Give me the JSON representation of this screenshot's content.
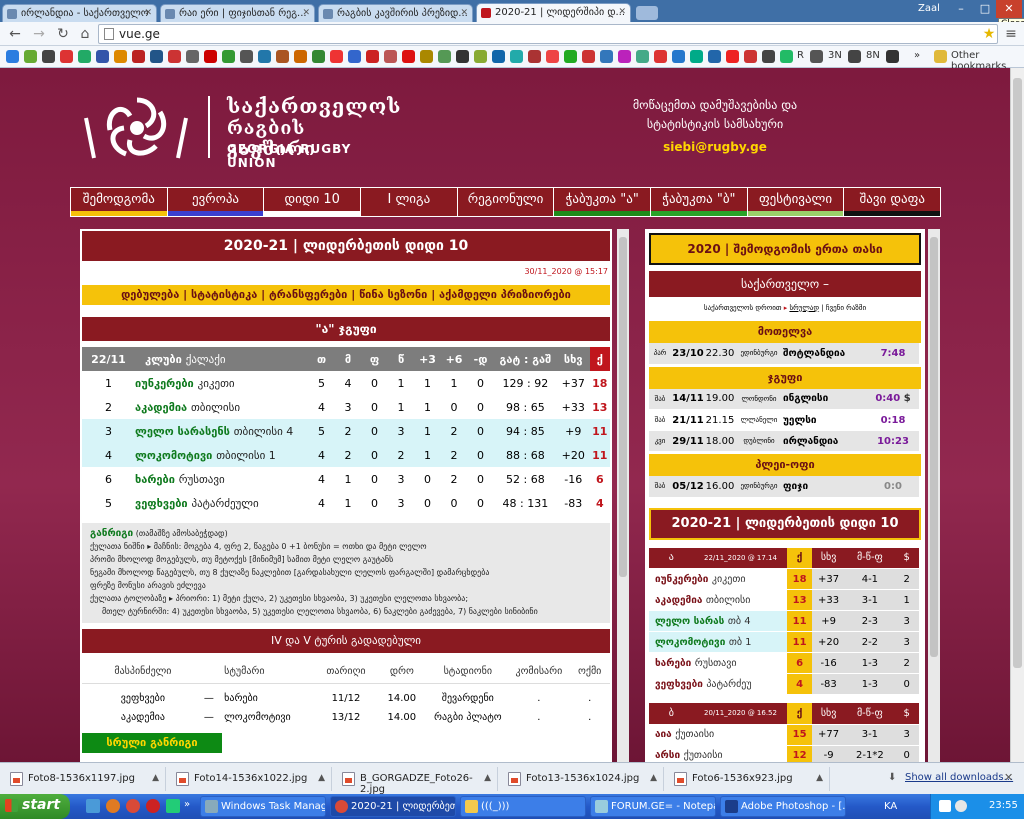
{
  "browser": {
    "tabs": [
      {
        "title": "ირლანდია - საქართველო"
      },
      {
        "title": "რაი ერი | ფიჯისთან რეგ..."
      },
      {
        "title": "რაგბის კავშირის პრეზიდ..."
      },
      {
        "title": "2020-21 | ლიდერშიპი დ..."
      }
    ],
    "user": "Zaal",
    "close_tip": "Close",
    "url": "vue.ge",
    "bookmarks": {
      "r": "R",
      "w": "W",
      "n3": "3N",
      "n8": "8N",
      "other": "Other bookmarks"
    }
  },
  "site": {
    "logo_line1": "საქართველოს",
    "logo_line2": "რაგბის კავშირი",
    "logo_line3": "GEORGIA RUGBY UNION",
    "contact_line1": "მოწაცემთა დამუშავებისა და",
    "contact_line2": "სტატისტიკის სამსახური",
    "contact_email": "siebi@rugby.ge",
    "nav": [
      {
        "label": "შემოდგომა",
        "color": "#f5c20a"
      },
      {
        "label": "ევროპა",
        "color": "#3b3fd0"
      },
      {
        "label": "დიდი 10",
        "color": "#ffffff"
      },
      {
        "label": "I ლიგა",
        "color": "#8a1a21"
      },
      {
        "label": "რეგიონული",
        "color": "#8a1a21"
      },
      {
        "label": "ჭაბუკთა \"ა\"",
        "color": "#1f8a1a"
      },
      {
        "label": "ჭაბუკთა \"ბ\"",
        "color": "#2aa32a"
      },
      {
        "label": "ფესტივალი",
        "color": "#9ad06a"
      },
      {
        "label": "შავი დაფა",
        "color": "#111111"
      }
    ]
  },
  "left": {
    "title": "2020-21 | ლიდერბეთის დიდი 10",
    "updated": "30/11_2020 @ 15:17",
    "links": [
      "დებულება",
      "სტატისტიკა",
      "ტრანსფერები",
      "წინა სეზონი",
      "აქამდელი პრიზიორები"
    ],
    "group_title": "\"ა\" ჯგუფი",
    "table_head": {
      "round": "22/11",
      "club": "კლუბი",
      "city": "ქალაქი",
      "p": "თ",
      "w": "მ",
      "d": "ფ",
      "l": "წ",
      "b1": "+3",
      "b2": "+6",
      "b3": "-დ",
      "score": "გატ : გაშ",
      "diff": "სხვ",
      "pts": "ქ"
    },
    "rows": [
      {
        "pos": "1",
        "team": "იუნკერები",
        "city": "კიკეთი",
        "p": "5",
        "w": "4",
        "d": "0",
        "l": "1",
        "b1": "1",
        "b2": "1",
        "b3": "0",
        "for": "129",
        "against": "92",
        "diff": "+37",
        "pts": "18",
        "hl": false
      },
      {
        "pos": "2",
        "team": "აკადემია",
        "city": "თბილისი",
        "p": "4",
        "w": "3",
        "d": "0",
        "l": "1",
        "b1": "1",
        "b2": "0",
        "b3": "0",
        "for": "98",
        "against": "65",
        "diff": "+33",
        "pts": "13",
        "hl": false
      },
      {
        "pos": "3",
        "team": "ლელო სარასენს",
        "city": "თბილისი 4",
        "p": "5",
        "w": "2",
        "d": "0",
        "l": "3",
        "b1": "1",
        "b2": "2",
        "b3": "0",
        "for": "94",
        "against": "85",
        "diff": "+9",
        "pts": "11",
        "hl": true
      },
      {
        "pos": "4",
        "team": "ლოკომოტივი",
        "city": "თბილისი 1",
        "p": "4",
        "w": "2",
        "d": "0",
        "l": "2",
        "b1": "1",
        "b2": "2",
        "b3": "0",
        "for": "88",
        "against": "68",
        "diff": "+20",
        "pts": "11",
        "hl": true
      },
      {
        "pos": "6",
        "team": "ხარები",
        "city": "რუსთავი",
        "p": "4",
        "w": "1",
        "d": "0",
        "l": "3",
        "b1": "0",
        "b2": "2",
        "b3": "0",
        "for": "52",
        "against": "68",
        "diff": "-16",
        "pts": "6",
        "hl": false
      },
      {
        "pos": "5",
        "team": "ვეფხვები",
        "city": "პატარძეული",
        "p": "4",
        "w": "1",
        "d": "0",
        "l": "3",
        "b1": "0",
        "b2": "0",
        "b3": "0",
        "for": "48",
        "against": "131",
        "diff": "-83",
        "pts": "4",
        "hl": false
      }
    ],
    "notes": {
      "title": "განრიგი",
      "title_sub": "(თამაშზე ამოსაბეჭდად)",
      "l1": "ქულათა ნიშნი ▸ მაჩნის: მოგება 4, ფრე 2, წაგება 0   +1 ბონუსი = ოთხი და მეტი ლელო",
      "l2": "პრომი მხოლოდ მოგებულს, თუ მეტოქეს [მინიმუმ] სამით მეტი ლელო გაუტანს",
      "l3": "ნეგამი მხოლოდ წაგებულს, თუ 8 ქულაზე ნაკლებით [გარდასახული ლელოს ფარგალში] დამარცხდება",
      "l4": "ფრეზე მონუსი არავის ეძლევა",
      "l5": "ქულათა ტოლობაზე ▸ პრიორი: 1) მეტი ქულა, 2) უკეთესი სხვაობა, 3) უკეთესი ლელოთა სხვაობა;",
      "l6": "მთელ ტურნირში: 4) უკეთესი სხვაობა, 5) უკეთესი ლელოთა სხვაობა, 6) ნაკლები გაძევება, 7) ნაკლები სინიბინი"
    },
    "fixtures_title": "IV და V ტურის გადადებული",
    "fixtures_head": {
      "home": "მასპინძელი",
      "away": "სტუმარი",
      "date": "თარიღი",
      "time": "დრო",
      "venue": "სტადიონი",
      "comm": "კომისარი",
      "ref": "ოქმი"
    },
    "fixtures": [
      {
        "home": "ვეფხვები",
        "dash": "—",
        "away": "ხარები",
        "date": "11/12",
        "time": "14.00",
        "venue": "შევარდენი",
        "comm": ".",
        "ref": "."
      },
      {
        "home": "აკადემია",
        "dash": "—",
        "away": "ლოკომოტივი",
        "date": "13/12",
        "time": "14.00",
        "venue": "რაგბი პლატო",
        "comm": ".",
        "ref": "."
      }
    ],
    "full_schedule": "სრული განრიგი"
  },
  "right": {
    "cup_title": "2020 | შემოდგომის ერთა თასი",
    "country": "საქართველო –",
    "sub_l": "საქართველოს დროით",
    "sub_m": "სრულად",
    "sub_r": "ჩვენი რაზმი",
    "sec1": "მოთელვა",
    "sec2": "ჯგუფი",
    "sec3": "პლეი-ოფი",
    "matches": [
      {
        "day": "პარ",
        "date": "23/10",
        "time": "22.30",
        "venue": "ედინბურგი",
        "opp": "შოტლანდია",
        "score": "7:48",
        "g": "s1"
      },
      {
        "day": "შაბ",
        "date": "14/11",
        "time": "19.00",
        "venue": "ლონდონი",
        "opp": "ინგლისი",
        "score": "0:40",
        "g": "s2"
      },
      {
        "day": "შაბ",
        "date": "21/11",
        "time": "21.15",
        "venue": "ლლანელი",
        "opp": "უელსი",
        "score": "0:18",
        "g": "s2"
      },
      {
        "day": "კვი",
        "date": "29/11",
        "time": "18.00",
        "venue": "დუბლინი",
        "opp": "ირლანდია",
        "score": "10:23",
        "g": "s2"
      },
      {
        "day": "შაბ",
        "date": "05/12",
        "time": "16.00",
        "venue": "ედინბურგი",
        "opp": "ფიჯი",
        "score": "0:0",
        "g": "s3"
      }
    ],
    "money_mark": "$",
    "d10_title": "2020-21 | ლიდერბეთის დიდი 10",
    "ga": {
      "label": "ა",
      "date": "22/11_2020 @ 17.14",
      "pts": "ქ",
      "diff": "სხვ",
      "bd": "მ-წ-ფ",
      "b": "$"
    },
    "ga_rows": [
      {
        "team": "იუნკერები",
        "city": "კიკეთი",
        "pts": "18",
        "diff": "+37",
        "wld": "4-1",
        "b": "2",
        "hl": false
      },
      {
        "team": "აკადემია",
        "city": "თბილისი",
        "pts": "13",
        "diff": "+33",
        "wld": "3-1",
        "b": "1",
        "hl": false
      },
      {
        "team": "ლელო სარას",
        "city": "თბ 4",
        "pts": "11",
        "diff": "+9",
        "wld": "2-3",
        "b": "3",
        "hl": true
      },
      {
        "team": "ლოკომოტივი",
        "city": "თბ 1",
        "pts": "11",
        "diff": "+20",
        "wld": "2-2",
        "b": "3",
        "hl": true
      },
      {
        "team": "ხარები",
        "city": "რუსთავი",
        "pts": "6",
        "diff": "-16",
        "wld": "1-3",
        "b": "2",
        "hl": false
      },
      {
        "team": "ვეფხვები",
        "city": "პატარძეუ",
        "pts": "4",
        "diff": "-83",
        "wld": "1-3",
        "b": "0",
        "hl": false
      }
    ],
    "gb": {
      "label": "ბ",
      "date": "20/11_2020 @ 16.52",
      "pts": "ქ",
      "diff": "სხვ",
      "bd": "მ-წ-ფ",
      "b": "$"
    },
    "gb_rows": [
      {
        "team": "აია",
        "city": "ქუთაისი",
        "pts": "15",
        "diff": "+77",
        "wld": "3-1",
        "b": "3"
      },
      {
        "team": "არსი",
        "city": "ქუთაისი",
        "pts": "12",
        "diff": "-9",
        "wld": "2-1*2",
        "b": "0"
      }
    ]
  },
  "downloads": {
    "files": [
      "Foto8-1536x1197.jpg",
      "Foto14-1536x1022.jpg",
      "B_GORGADZE_Foto26-2.jpg",
      "Foto13-1536x1024.jpg",
      "Foto6-1536x923.jpg"
    ],
    "show_all": "Show all downloads..."
  },
  "taskbar": {
    "start": "start",
    "items": [
      "Windows Task Manager",
      "2020-21 | ლიდერბეთი...",
      "(((_)))",
      "FORUM.GE= - Notepad",
      "Adobe Photoshop - [..."
    ],
    "lang": "KA",
    "clock": "23:55"
  }
}
